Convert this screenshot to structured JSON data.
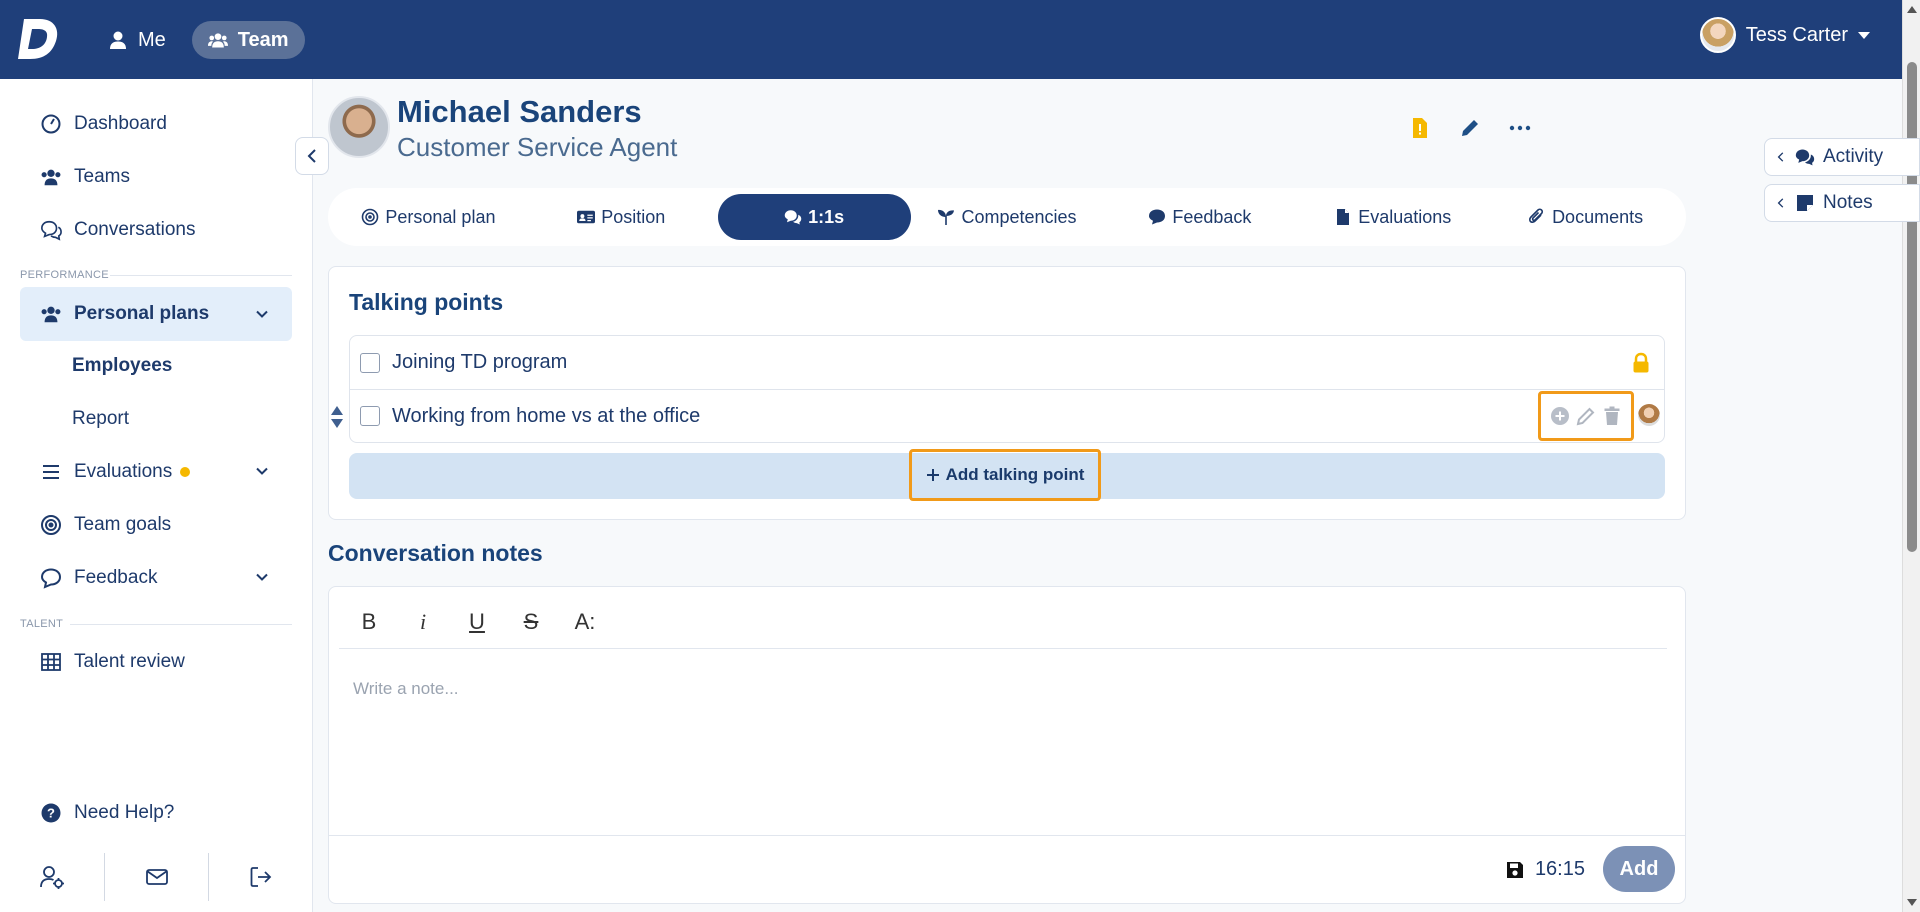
{
  "topbar": {
    "logo": "D",
    "nav": [
      {
        "label": "Me",
        "icon": "user-icon"
      },
      {
        "label": "Team",
        "icon": "users-icon"
      }
    ],
    "user_name": "Tess Carter"
  },
  "sidebar": {
    "items": [
      {
        "label": "Dashboard",
        "icon": "gauge-icon"
      },
      {
        "label": "Teams",
        "icon": "users-icon"
      },
      {
        "label": "Conversations",
        "icon": "chat-icon"
      }
    ],
    "section_performance": "PERFORMANCE",
    "personal_plans": "Personal plans",
    "sub_items": [
      "Employees",
      "Report"
    ],
    "evaluations": "Evaluations",
    "team_goals": "Team goals",
    "feedback": "Feedback",
    "section_talent": "TALENT",
    "talent_review": "Talent review",
    "need_help": "Need Help?"
  },
  "profile": {
    "name": "Michael Sanders",
    "role": "Customer Service Agent"
  },
  "side_panels": {
    "activity": "Activity",
    "notes": "Notes"
  },
  "tabs": [
    {
      "label": "Personal plan",
      "icon": "target-icon"
    },
    {
      "label": "Position",
      "icon": "id-card-icon"
    },
    {
      "label": "1:1s",
      "icon": "comments-icon",
      "active": true
    },
    {
      "label": "Competencies",
      "icon": "seedling-icon"
    },
    {
      "label": "Feedback",
      "icon": "comment-icon"
    },
    {
      "label": "Evaluations",
      "icon": "file-icon"
    },
    {
      "label": "Documents",
      "icon": "paperclip-icon"
    }
  ],
  "talking_points": {
    "title": "Talking points",
    "items": [
      {
        "text": "Joining TD program",
        "locked": true
      },
      {
        "text": "Working from home vs at the office",
        "locked": false
      }
    ],
    "add_label": "Add talking point"
  },
  "conversation_notes": {
    "title": "Conversation notes",
    "placeholder": "Write a note...",
    "toolbar": [
      "B",
      "i",
      "U",
      "S",
      "A:"
    ],
    "saved_time": "16:15",
    "add_label": "Add"
  },
  "colors": {
    "primary": "#1f3f7a",
    "accent_highlight": "#f19a19",
    "lock_yellow": "#f5b800"
  }
}
